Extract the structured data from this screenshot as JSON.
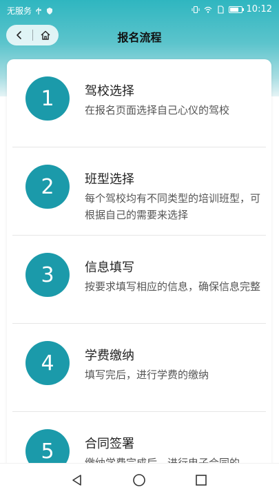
{
  "status_bar": {
    "carrier": "无服务",
    "time": "10:12"
  },
  "header": {
    "title": "报名流程"
  },
  "steps": [
    {
      "number": "1",
      "title": "驾校选择",
      "desc": "在报名页面选择自己心仪的驾校"
    },
    {
      "number": "2",
      "title": "班型选择",
      "desc": "每个驾校均有不同类型的培训班型，可根据自己的需要来选择"
    },
    {
      "number": "3",
      "title": "信息填写",
      "desc": "按要求填写相应的信息，确保信息完整"
    },
    {
      "number": "4",
      "title": "学费缴纳",
      "desc": "填写完后，进行学费的缴纳"
    },
    {
      "number": "5",
      "title": "合同签署",
      "desc": "缴纳学费完成后，进行电子合同的"
    }
  ],
  "colors": {
    "accent": "#1b9aaa",
    "header_gradient_top": "#2fb6c0"
  },
  "icons": {
    "back": "back-arrow-icon",
    "home": "home-icon",
    "nav_back": "triangle-back-icon",
    "nav_home": "circle-home-icon",
    "nav_recent": "square-recents-icon"
  }
}
